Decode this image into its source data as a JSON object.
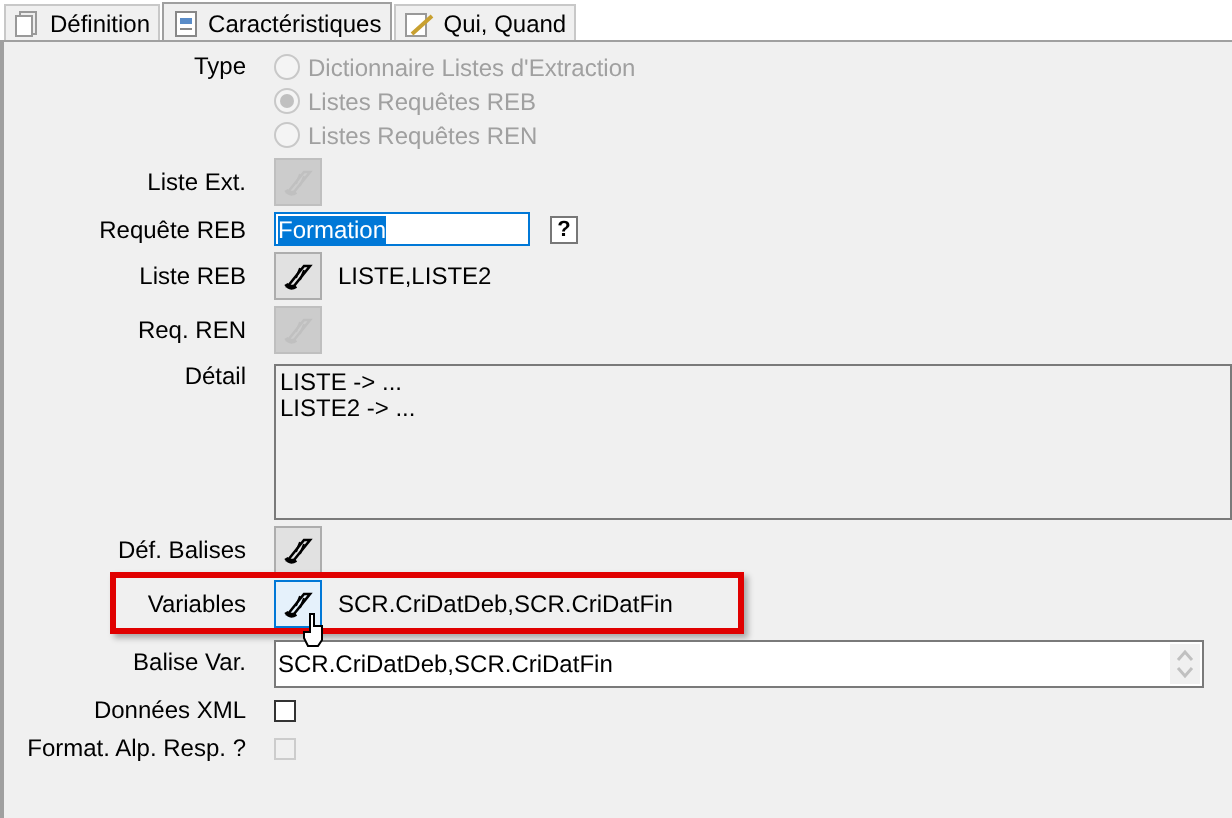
{
  "tabs": [
    {
      "label": "Définition",
      "selected": false
    },
    {
      "label": "Caractéristiques",
      "selected": true
    },
    {
      "label": "Qui, Quand",
      "selected": false
    }
  ],
  "rows": [
    {
      "kind": "radio_group",
      "label": "Type",
      "options": [
        {
          "label": "Dictionnaire Listes d'Extraction",
          "selected": false,
          "disabled": true
        },
        {
          "label": "Listes Requêtes REB",
          "selected": true,
          "disabled": true
        },
        {
          "label": "Listes Requêtes REN",
          "selected": false,
          "disabled": true
        }
      ]
    },
    {
      "kind": "button",
      "label": "Liste Ext.",
      "disabled": true
    },
    {
      "kind": "field",
      "label": "Requête REB",
      "value": "Formation",
      "help": "?"
    },
    {
      "kind": "button",
      "label": "Liste REB",
      "disabled": false,
      "text": "LISTE,LISTE2"
    },
    {
      "kind": "button",
      "label": "Req. REN",
      "disabled": true
    },
    {
      "kind": "textarea",
      "label": "Détail",
      "lines": [
        "LISTE -> ...",
        "LISTE2 -> ..."
      ]
    },
    {
      "kind": "button",
      "label": "Déf. Balises",
      "disabled": false
    },
    {
      "kind": "button",
      "label": "Variables",
      "disabled": false,
      "hovered": true,
      "highlighted": true,
      "text": "SCR.CriDatDeb,SCR.CriDatFin"
    },
    {
      "kind": "spin_field",
      "label": "Balise Var.",
      "value": "SCR.CriDatDeb,SCR.CriDatFin"
    },
    {
      "kind": "checkbox",
      "label": "Données XML",
      "checked": false,
      "disabled": false
    },
    {
      "kind": "checkbox",
      "label": "Format. Alp. Resp. ?",
      "checked": false,
      "disabled": true
    }
  ]
}
